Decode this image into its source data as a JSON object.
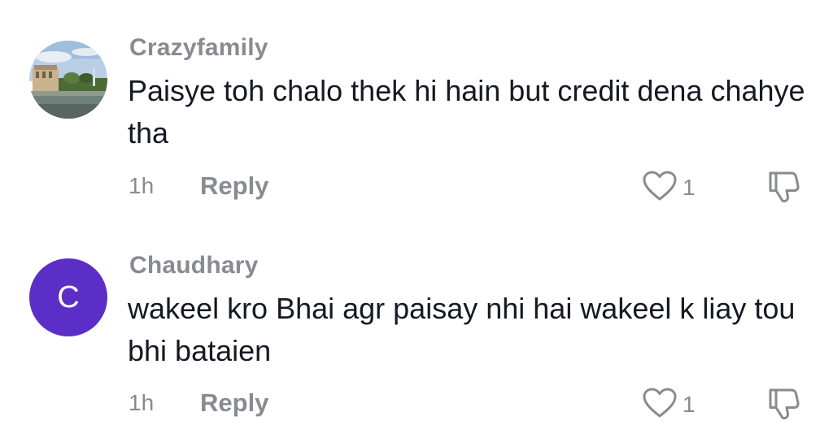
{
  "comments": [
    {
      "username": "Crazyfamily",
      "avatar": "photo-avatar",
      "text": "Paisye toh chalo thek hi hain but credit dena chahye tha",
      "time": "1h",
      "reply_label": "Reply",
      "like_count": "1"
    },
    {
      "username": "Chaudhary",
      "avatar_letter": "C",
      "avatar_color": "#5b2fc7",
      "text": "wakeel kro Bhai agr paisay nhi hai wakeel k liay tou bhi bataien",
      "time": "1h",
      "reply_label": "Reply",
      "like_count": "1"
    }
  ],
  "colors": {
    "secondary_text": "#8a8b91",
    "primary_text": "#161823"
  }
}
